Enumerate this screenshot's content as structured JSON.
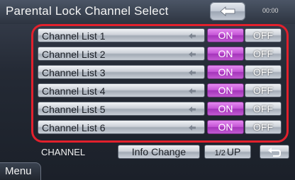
{
  "header": {
    "title": "Parental Lock Channel Select",
    "clock": "00:00"
  },
  "channels": [
    {
      "label": "Channel List 1",
      "on": "ON",
      "off": "OFF"
    },
    {
      "label": "Channel List 2",
      "on": "ON",
      "off": "OFF"
    },
    {
      "label": "Channel List 3",
      "on": "ON",
      "off": "OFF"
    },
    {
      "label": "Channel List 4",
      "on": "ON",
      "off": "OFF"
    },
    {
      "label": "Channel List 5",
      "on": "ON",
      "off": "OFF"
    },
    {
      "label": "Channel List 6",
      "on": "ON",
      "off": "OFF"
    }
  ],
  "bottom": {
    "channel_label": "CHANNEL",
    "info_change": "Info Change",
    "up_prefix": "1/2",
    "up_label": "UP"
  },
  "menu": {
    "label": "Menu"
  },
  "colors": {
    "on_active": "#c454d6",
    "highlight_frame": "#e2202c"
  },
  "icons": {
    "back": "back-arrow-icon",
    "return": "return-icon",
    "row_arrow": "left-arrow-icon"
  }
}
